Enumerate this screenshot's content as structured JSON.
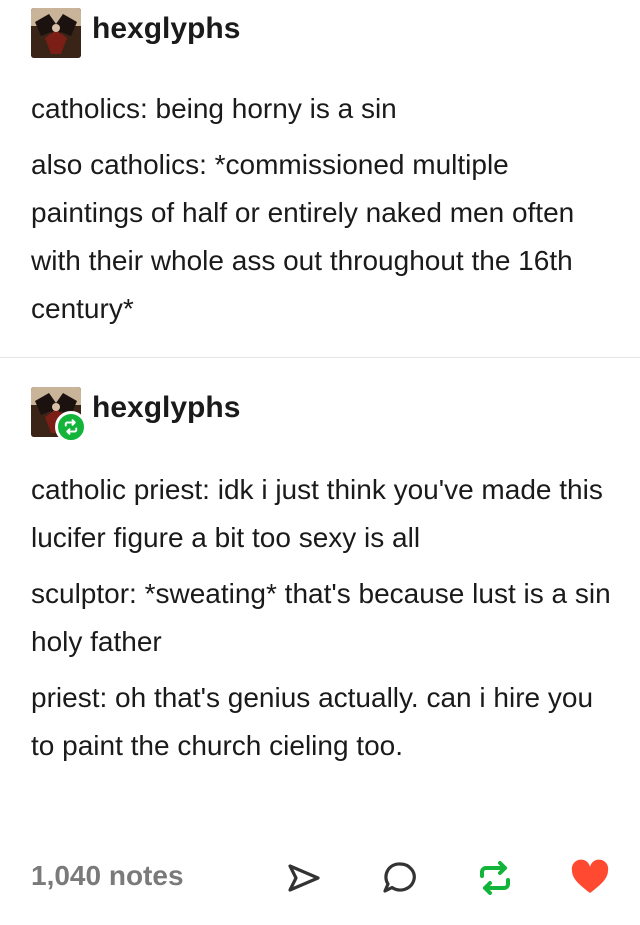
{
  "posts": [
    {
      "username": "hexglyphs",
      "reblogged": false,
      "paragraphs": [
        "catholics: being horny is a sin",
        "also catholics: *commissioned multiple paintings of half or entirely naked men often with their whole ass out throughout the 16th century*"
      ]
    },
    {
      "username": "hexglyphs",
      "reblogged": true,
      "paragraphs": [
        "catholic priest: idk i just think you've made this lucifer figure a bit too sexy is all",
        "sculptor: *sweating* that's because lust is a sin holy father",
        "priest: oh that's genius actually. can i hire you to paint the church cieling too."
      ]
    }
  ],
  "footer": {
    "notes": "1,040 notes",
    "icons": [
      "share-icon",
      "reply-icon",
      "reblog-icon",
      "like-icon"
    ]
  },
  "colors": {
    "reblog_green": "#12b53a",
    "like_red": "#ff4930",
    "notes_gray": "#7a7a7a",
    "divider": "#e6e6e6"
  }
}
